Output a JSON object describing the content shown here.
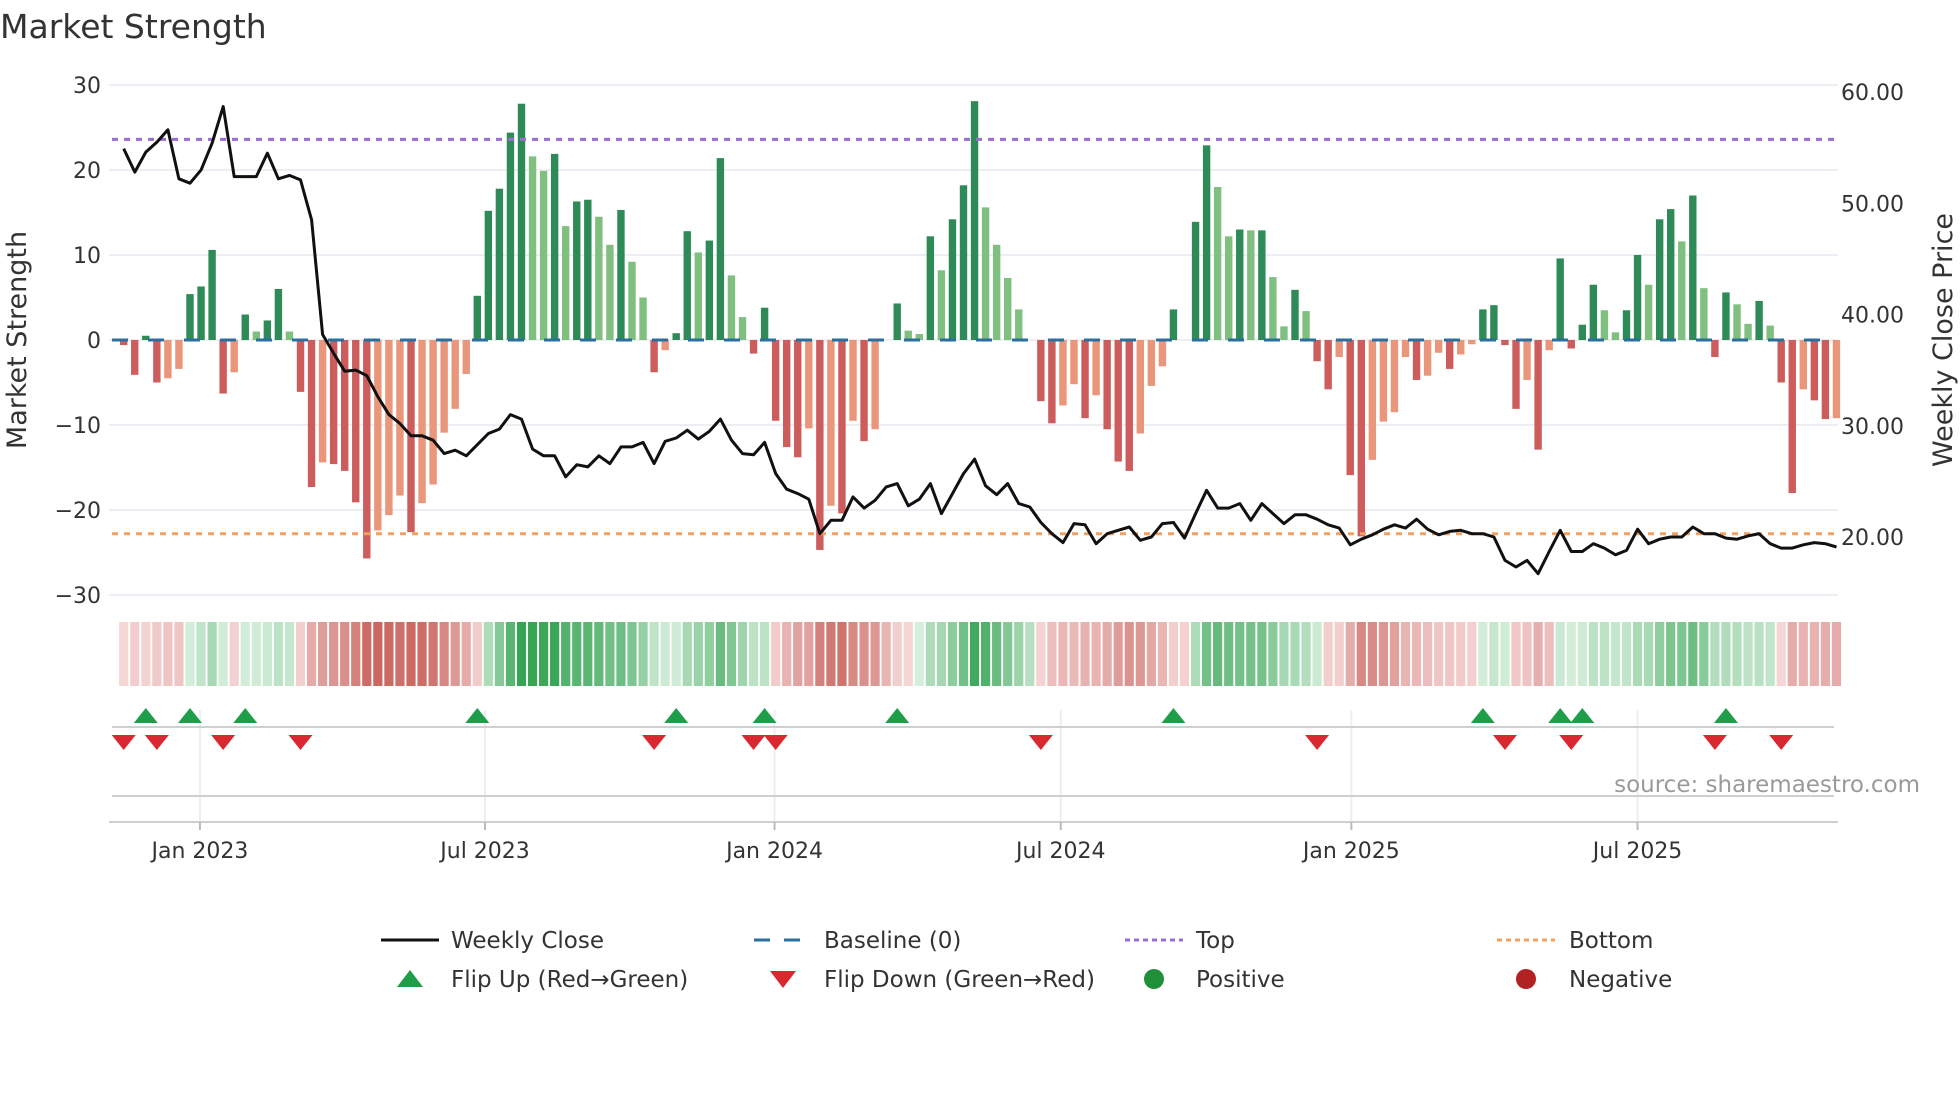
{
  "chart_data": {
    "type": "bar",
    "title": "Market Strength",
    "ylabel": "Market Strength",
    "y2label": "Weekly Close Price",
    "ylim": [
      -30,
      30
    ],
    "y2lim": [
      20,
      60
    ],
    "yticks": [
      "30",
      "20",
      "10",
      "0",
      "−10",
      "−20",
      "−30"
    ],
    "ytick_values": [
      30,
      20,
      10,
      0,
      -10,
      -20,
      -30
    ],
    "y2ticks": [
      "60.00",
      "50.00",
      "40.00",
      "30.00",
      "20.00"
    ],
    "y2tick_values": [
      60,
      50,
      40,
      30,
      20
    ],
    "xticks": [
      {
        "label": "Jan 2023",
        "week": 6.9
      },
      {
        "label": "Jul 2023",
        "week": 32.7
      },
      {
        "label": "Jan 2024",
        "week": 58.9
      },
      {
        "label": "Jul 2024",
        "week": 84.8
      },
      {
        "label": "Jan 2025",
        "week": 111.1
      },
      {
        "label": "Jul 2025",
        "week": 137.0
      }
    ],
    "top_level": 23.6,
    "bottom_level": -22.8,
    "baseline": 0,
    "strength": [
      -0.6,
      -4.1,
      0.5,
      -5.0,
      -4.5,
      -3.4,
      5.4,
      6.3,
      10.6,
      -6.3,
      -3.8,
      3.0,
      1.0,
      2.3,
      6.0,
      1.0,
      -6.1,
      -17.3,
      -14.4,
      -14.6,
      -15.4,
      -19.1,
      -25.7,
      -22.4,
      -20.6,
      -18.3,
      -22.6,
      -19.2,
      -17.0,
      -10.9,
      -8.1,
      -4.0,
      5.2,
      15.2,
      17.8,
      24.4,
      27.8,
      21.6,
      19.9,
      21.9,
      13.4,
      16.3,
      16.5,
      14.5,
      11.2,
      15.3,
      9.2,
      5.0,
      -3.8,
      -1.2,
      0.8,
      12.8,
      10.3,
      11.7,
      21.4,
      7.6,
      2.7,
      -1.6,
      3.8,
      -9.5,
      -12.6,
      -13.8,
      -10.4,
      -24.7,
      -19.5,
      -20.4,
      -9.5,
      -11.9,
      -10.5,
      0,
      4.3,
      1.1,
      0.7,
      12.2,
      8.2,
      14.2,
      18.2,
      28.1,
      15.6,
      11.2,
      7.3,
      3.6,
      0,
      -7.2,
      -9.8,
      -7.7,
      -5.2,
      -9.2,
      -6.5,
      -10.5,
      -14.3,
      -15.4,
      -11.0,
      -5.4,
      -3.1,
      3.6,
      0,
      13.9,
      22.9,
      18.0,
      12.2,
      13.0,
      12.9,
      12.9,
      7.4,
      1.6,
      5.9,
      3.4,
      -2.5,
      -5.8,
      -2.0,
      -15.9,
      -23.1,
      -14.1,
      -9.6,
      -8.5,
      -2.0,
      -4.7,
      -4.2,
      -1.5,
      -3.4,
      -1.7,
      -0.5,
      3.6,
      4.1,
      -0.6,
      -8.1,
      -4.7,
      -12.9,
      -1.2,
      9.6,
      -1.0,
      1.8,
      6.5,
      3.5,
      0.9,
      3.5,
      10.0,
      6.5,
      14.2,
      15.4,
      11.6,
      17.0,
      6.1,
      -2.0,
      5.6,
      4.2,
      1.9,
      4.6,
      1.7,
      -5.0,
      -18.0,
      -5.8,
      -7.1,
      -9.3,
      -9.2
    ],
    "weekly_close": [
      54.9,
      52.8,
      54.6,
      55.5,
      56.6,
      52.2,
      51.8,
      53.0,
      55.4,
      58.7,
      52.4,
      52.4,
      52.4,
      54.5,
      52.2,
      52.5,
      52.1,
      48.5,
      38.2,
      36.5,
      34.9,
      35.0,
      34.5,
      32.6,
      31.0,
      30.2,
      29.1,
      29.1,
      28.7,
      27.5,
      27.8,
      27.3,
      28.3,
      29.3,
      29.7,
      31.0,
      30.6,
      27.9,
      27.3,
      27.3,
      25.4,
      26.5,
      26.3,
      27.3,
      26.6,
      28.1,
      28.1,
      28.5,
      26.6,
      28.6,
      28.9,
      29.6,
      28.8,
      29.5,
      30.6,
      28.7,
      27.5,
      27.4,
      28.5,
      25.7,
      24.3,
      23.9,
      23.4,
      20.3,
      21.5,
      21.5,
      23.6,
      22.6,
      23.3,
      24.5,
      24.8,
      22.8,
      23.4,
      24.8,
      22.1,
      23.9,
      25.7,
      27.0,
      24.6,
      23.8,
      24.8,
      23.0,
      22.7,
      21.3,
      20.3,
      19.5,
      21.2,
      21.1,
      19.4,
      20.3,
      20.6,
      20.9,
      19.7,
      20.0,
      21.2,
      21.3,
      19.9,
      22.1,
      24.2,
      22.6,
      22.6,
      23.0,
      21.5,
      23.0,
      22.1,
      21.2,
      22.0,
      22.0,
      21.6,
      21.1,
      20.8,
      19.3,
      19.8,
      20.2,
      20.7,
      21.1,
      20.8,
      21.6,
      20.7,
      20.2,
      20.5,
      20.6,
      20.3,
      20.3,
      20.0,
      17.9,
      17.3,
      17.9,
      16.7,
      18.7,
      20.6,
      18.7,
      18.7,
      19.4,
      19.0,
      18.4,
      18.8,
      20.7,
      19.4,
      19.8,
      20.0,
      20.0,
      20.9,
      20.3,
      20.3,
      19.9,
      19.8,
      20.1,
      20.3,
      19.4,
      19.0,
      19.0,
      19.3,
      19.5,
      19.4,
      19.1
    ],
    "flip_up_weeks": [
      2,
      6,
      11,
      32,
      50,
      58,
      70,
      95,
      123,
      130,
      132,
      145
    ],
    "flip_down_weeks": [
      0,
      3,
      9,
      16,
      48,
      57,
      59,
      83,
      108,
      125,
      131,
      144,
      150
    ],
    "legend": [
      {
        "label": "Weekly Close",
        "kind": "line",
        "color": "#111111"
      },
      {
        "label": "Baseline (0)",
        "kind": "dash",
        "color": "#2b6f9e"
      },
      {
        "label": "Top",
        "kind": "dot",
        "color": "#9b6dd6"
      },
      {
        "label": "Bottom",
        "kind": "dot",
        "color": "#f0a060"
      },
      {
        "label": "Flip Up (Red→Green)",
        "kind": "tri-up",
        "color": "#1e9e48"
      },
      {
        "label": "Flip Down (Green→Red)",
        "kind": "tri-down",
        "color": "#d9282f"
      },
      {
        "label": "Positive",
        "kind": "circle",
        "color": "#1f8f3a"
      },
      {
        "label": "Negative",
        "kind": "circle",
        "color": "#b22222"
      }
    ],
    "colors": {
      "pos_strong": "#2e8b57",
      "pos_weak": "#7fbf7f",
      "neg_strong": "#cd5c5c",
      "neg_weak": "#e9967a",
      "line": "#111111",
      "baseline": "#2b6f9e",
      "top": "#9b6dd6",
      "bottom": "#f0a060"
    }
  },
  "source": "source: sharemaestro.com"
}
